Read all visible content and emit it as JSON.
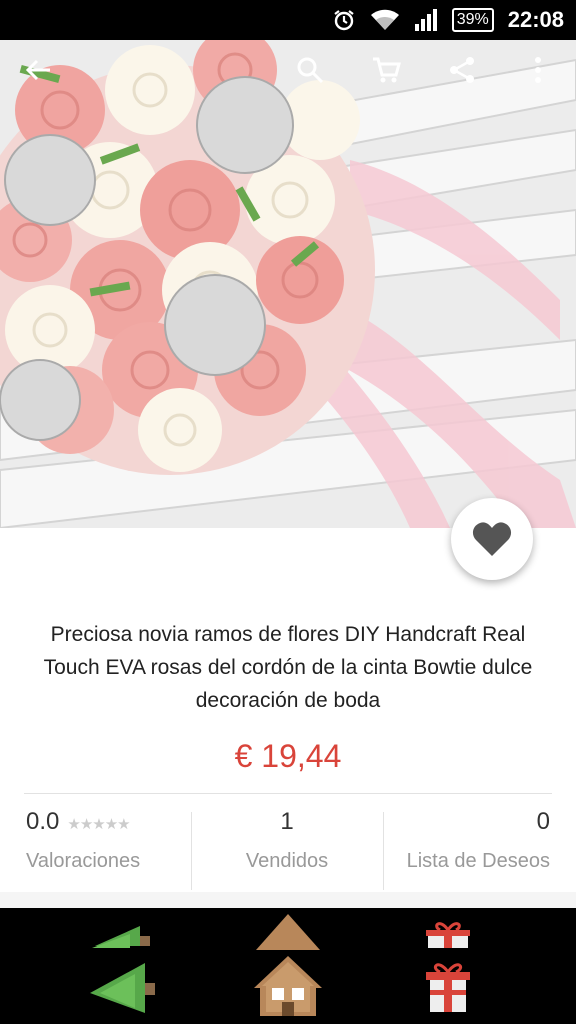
{
  "status_bar": {
    "battery": "39%",
    "time": "22:08",
    "icons": [
      "alarm-icon",
      "wifi-icon",
      "signal-icon",
      "battery-icon"
    ]
  },
  "toolbar": {
    "icons": [
      "back-arrow-icon",
      "search-icon",
      "cart-icon",
      "share-icon",
      "more-vert-icon"
    ]
  },
  "product": {
    "title": "Preciosa novia ramos de flores DIY Handcraft Real Touch EVA rosas del cordón de la cinta Bowtie dulce decoración de boda",
    "price": "€ 19,44",
    "image_subject": "wedding bouquet",
    "price_color": "#d9443a"
  },
  "stats": {
    "rating": "0.0",
    "rating_stars": "★★★★★",
    "rating_label": "Valoraciones",
    "sold": "1",
    "sold_label": "Vendidos",
    "wishlist": "0",
    "wishlist_label": "Lista de Deseos"
  },
  "bottom_nav": {
    "items": [
      "tree-icon",
      "home-icon",
      "gift-icon"
    ]
  }
}
